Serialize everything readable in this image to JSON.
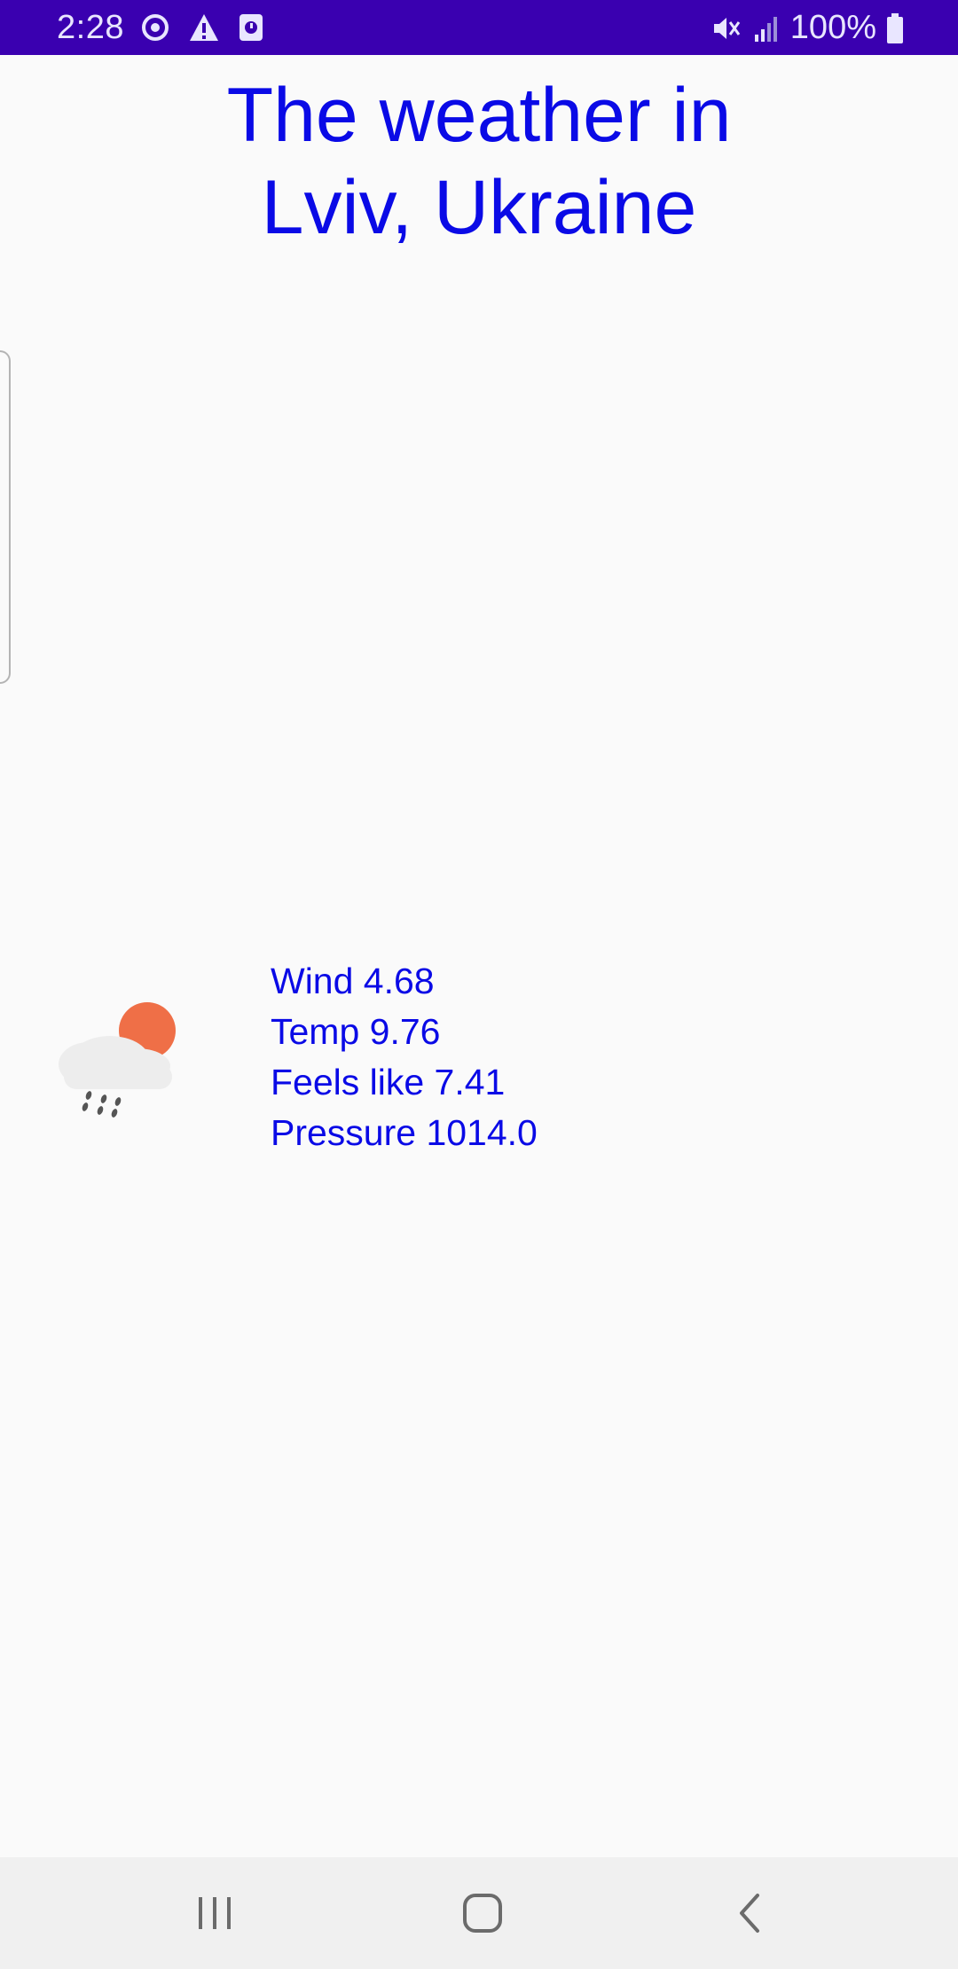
{
  "status_bar": {
    "time": "2:28",
    "battery": "100%",
    "icons": [
      "sync-icon",
      "warning-icon",
      "alarm-icon",
      "mute-icon",
      "signal-icon",
      "battery-icon"
    ],
    "background": "#3a00b0"
  },
  "title": {
    "line1": "The weather in",
    "line2": "Lviv, Ukraine",
    "color": "#0a0ae6"
  },
  "weather": {
    "icon": "rain-cloud-sun-icon",
    "wind": "Wind 4.68",
    "temp": "Temp 9.76",
    "feels_like": "Feels like 7.41",
    "pressure": "Pressure 1014.0"
  },
  "nav_bar": {
    "buttons": [
      "recent-apps-icon",
      "home-icon",
      "back-icon"
    ]
  }
}
